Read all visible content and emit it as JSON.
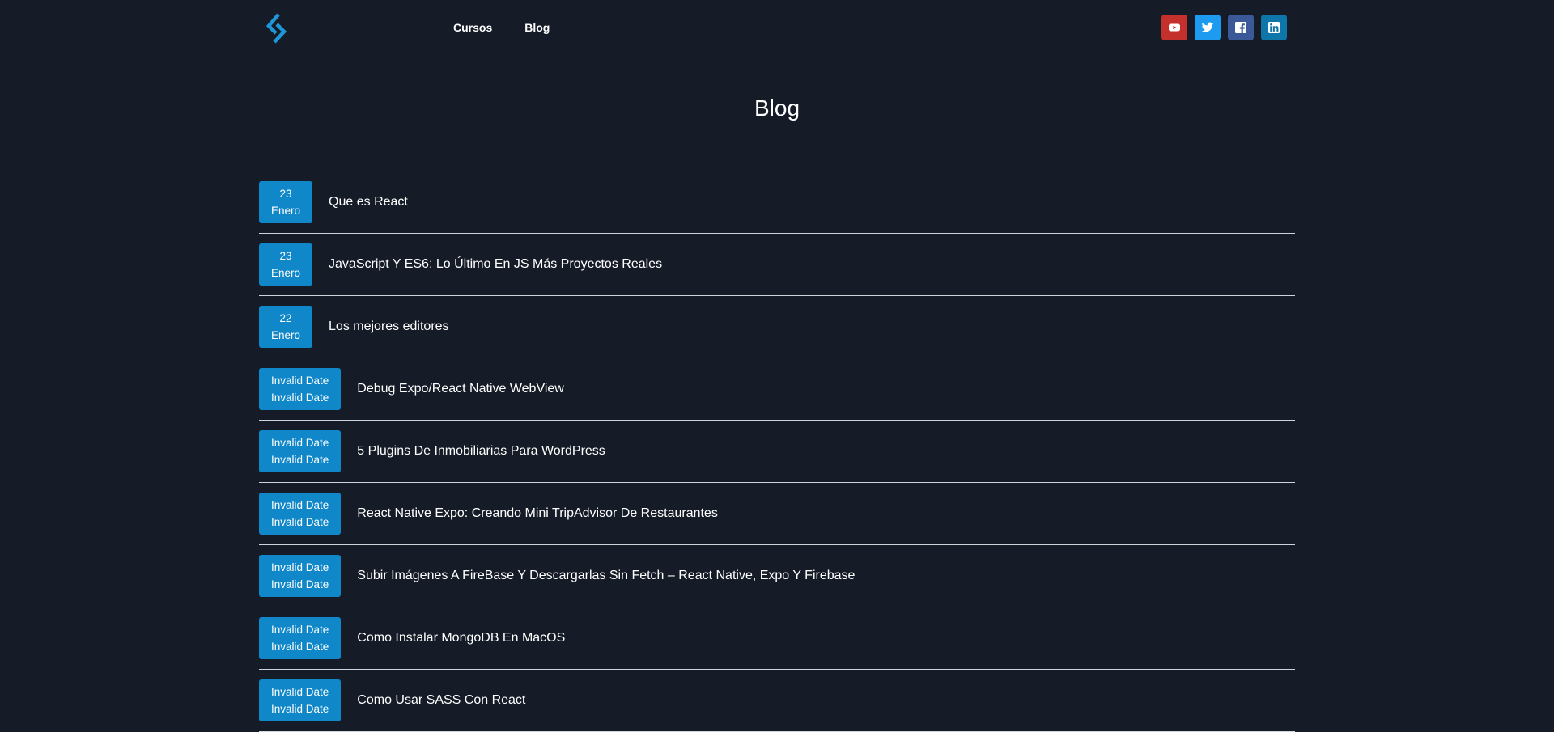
{
  "header": {
    "logo_icon": "chevron-brackets-logo-icon",
    "nav": [
      {
        "label": "Cursos"
      },
      {
        "label": "Blog"
      }
    ],
    "social": [
      {
        "icon": "youtube-icon",
        "color": "#c4302b"
      },
      {
        "icon": "twitter-icon",
        "color": "#1d9bf0"
      },
      {
        "icon": "facebook-icon",
        "color": "#3b5998"
      },
      {
        "icon": "linkedin-icon",
        "color": "#0e76a8"
      }
    ]
  },
  "main": {
    "title": "Blog",
    "posts": [
      {
        "day": "23",
        "month": "Enero",
        "title": "Que es React"
      },
      {
        "day": "23",
        "month": "Enero",
        "title": "JavaScript Y ES6: Lo Último En JS Más Proyectos Reales"
      },
      {
        "day": "22",
        "month": "Enero",
        "title": "Los mejores editores"
      },
      {
        "day": "Invalid Date",
        "month": "Invalid Date",
        "title": "Debug Expo/React Native WebView"
      },
      {
        "day": "Invalid Date",
        "month": "Invalid Date",
        "title": "5 Plugins De Inmobiliarias Para WordPress"
      },
      {
        "day": "Invalid Date",
        "month": "Invalid Date",
        "title": "React Native Expo: Creando Mini TripAdvisor De Restaurantes"
      },
      {
        "day": "Invalid Date",
        "month": "Invalid Date",
        "title": "Subir Imágenes A FireBase Y Descargarlas Sin Fetch – React Native, Expo Y Firebase"
      },
      {
        "day": "Invalid Date",
        "month": "Invalid Date",
        "title": "Como Instalar MongoDB En MacOS"
      },
      {
        "day": "Invalid Date",
        "month": "Invalid Date",
        "title": "Como Usar SASS Con React"
      }
    ]
  },
  "colors": {
    "background": "#161c27",
    "accent": "#0f87c9"
  }
}
